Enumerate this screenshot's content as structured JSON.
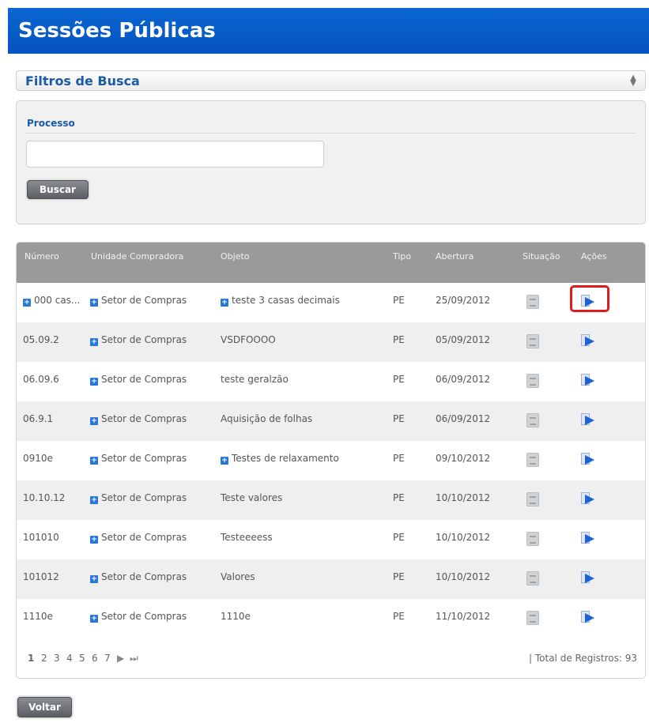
{
  "page": {
    "title": "Sessões Públicas"
  },
  "filters": {
    "title": "Filtros de Busca",
    "toggle_icon": "sort-toggle-icon",
    "process_label": "Processo",
    "process_value": "",
    "search_button": "Buscar"
  },
  "table": {
    "headers": [
      "Número",
      "Unidade Compradora",
      "Objeto",
      "Tipo",
      "Abertura",
      "Situação",
      "Ações"
    ],
    "rows": [
      {
        "numero": "000 cas...",
        "unidade": "Setor de Compras",
        "objeto": "teste 3 casas decimais",
        "tipo": "PE",
        "abertura": "25/09/2012",
        "numero_plus": true,
        "objeto_plus": true
      },
      {
        "numero": "05.09.2",
        "unidade": "Setor de Compras",
        "objeto": "VSDFOOOO",
        "tipo": "PE",
        "abertura": "05/09/2012",
        "numero_plus": false,
        "objeto_plus": false
      },
      {
        "numero": "06.09.6",
        "unidade": "Setor de Compras",
        "objeto": "teste geralzão",
        "tipo": "PE",
        "abertura": "06/09/2012",
        "numero_plus": false,
        "objeto_plus": false
      },
      {
        "numero": "06.9.1",
        "unidade": "Setor de Compras",
        "objeto": "Aquisição de folhas",
        "tipo": "PE",
        "abertura": "06/09/2012",
        "numero_plus": false,
        "objeto_plus": false
      },
      {
        "numero": "0910e",
        "unidade": "Setor de Compras",
        "objeto": "Testes de relaxamento",
        "tipo": "PE",
        "abertura": "09/10/2012",
        "numero_plus": false,
        "objeto_plus": true
      },
      {
        "numero": "10.10.12",
        "unidade": "Setor de Compras",
        "objeto": "Teste valores",
        "tipo": "PE",
        "abertura": "10/10/2012",
        "numero_plus": false,
        "objeto_plus": false
      },
      {
        "numero": "101010",
        "unidade": "Setor de Compras",
        "objeto": "Testeeeess",
        "tipo": "PE",
        "abertura": "10/10/2012",
        "numero_plus": false,
        "objeto_plus": false
      },
      {
        "numero": "101012",
        "unidade": "Setor de Compras",
        "objeto": "Valores",
        "tipo": "PE",
        "abertura": "10/10/2012",
        "numero_plus": false,
        "objeto_plus": false
      },
      {
        "numero": "1110e",
        "unidade": "Setor de Compras",
        "objeto": "1110e",
        "tipo": "PE",
        "abertura": "11/10/2012",
        "numero_plus": false,
        "objeto_plus": false
      }
    ],
    "situation_icon": "status-document-icon",
    "action_icon": "open-session-arrow-icon",
    "highlight_color": "#e01b1b"
  },
  "pagination": {
    "pages": [
      "1",
      "2",
      "3",
      "4",
      "5",
      "6",
      "7"
    ],
    "next": "▶",
    "last": "⏭",
    "total_text": "| Total de Registros: 93"
  },
  "footer": {
    "back_button": "Voltar"
  },
  "colors": {
    "header": "#0a66d2",
    "filter_title": "#1a5aa8",
    "table_header": "#9a9a9a"
  }
}
